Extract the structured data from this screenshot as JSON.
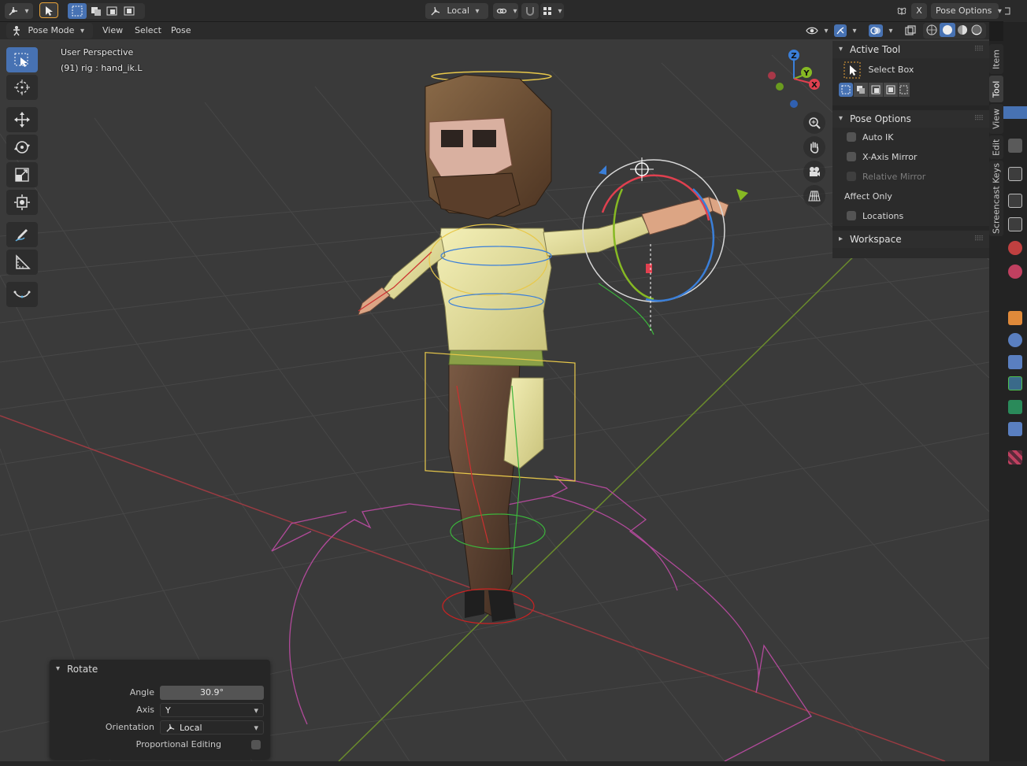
{
  "topbar": {
    "orientation": "Local",
    "pose_options": "Pose Options",
    "x_label": "X"
  },
  "header": {
    "mode": "Pose Mode",
    "menus": [
      "View",
      "Select",
      "Pose"
    ]
  },
  "viewport": {
    "perspective": "User Perspective",
    "object_info": "(91) rig : hand_ik.L",
    "gizmo_axes": [
      "Z",
      "Y",
      "X"
    ]
  },
  "toolbar": {
    "tools": [
      "select-box",
      "cursor",
      "move",
      "rotate",
      "scale",
      "transform",
      "annotate",
      "measure",
      "bone-roll"
    ],
    "active": "select-box"
  },
  "npanel": {
    "active_tool": {
      "header": "Active Tool",
      "tool_name": "Select Box"
    },
    "pose_options": {
      "header": "Pose Options",
      "auto_ik": "Auto IK",
      "x_axis_mirror": "X-Axis Mirror",
      "relative_mirror": "Relative Mirror",
      "affect_only": "Affect Only",
      "locations": "Locations"
    },
    "workspace": {
      "header": "Workspace"
    },
    "tabs": [
      "Item",
      "Tool",
      "View",
      "Edit",
      "Screencast Keys"
    ],
    "active_tab": "Tool"
  },
  "redo_panel": {
    "title": "Rotate",
    "angle_label": "Angle",
    "angle_value": "30.9°",
    "axis_label": "Axis",
    "axis_value": "Y",
    "orientation_label": "Orientation",
    "orientation_value": "Local",
    "proportional_label": "Proportional Editing"
  },
  "colors": {
    "accent": "#4772b3",
    "viewport_bg": "#3a3a3a",
    "grid_line": "#444444",
    "x_axis": "#9a3b42",
    "y_axis": "#6a8b2c",
    "axis_x_gizmo": "#e0404f",
    "axis_y_gizmo": "#86b923",
    "axis_z_gizmo": "#3a7fd9",
    "selection": "#e8c84a",
    "bone_widget": "#b14a9a"
  }
}
